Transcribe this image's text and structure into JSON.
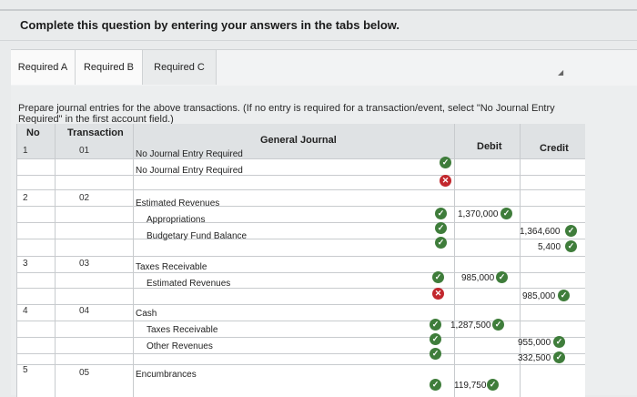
{
  "instruction": "Complete this question by entering your answers in the tabs below.",
  "tabs": [
    {
      "label": "Required A"
    },
    {
      "label": "Required B"
    },
    {
      "label": "Required C"
    }
  ],
  "prompt": "Prepare journal entries for the above transactions. (If no entry is required for a transaction/event, select \"No Journal Entry Required\" in the first account field.)",
  "table": {
    "headers": {
      "no": "No",
      "transaction": "Transaction",
      "journal": "General Journal",
      "debit": "Debit",
      "credit": "Credit"
    },
    "groups": [
      {
        "no": "1",
        "transaction": "01",
        "rows": [
          {
            "account": "No Journal Entry Required",
            "debit": "",
            "credit": ""
          },
          {
            "account": "No Journal Entry Required",
            "debit": "",
            "credit": ""
          }
        ]
      },
      {
        "no": "2",
        "transaction": "02",
        "rows": [
          {
            "account": "Estimated Revenues",
            "debit": "1,370,000",
            "credit": ""
          },
          {
            "account": "Appropriations",
            "debit": "",
            "credit": "1,364,600"
          },
          {
            "account": "Budgetary Fund Balance",
            "debit": "",
            "credit": "5,400"
          }
        ]
      },
      {
        "no": "3",
        "transaction": "03",
        "rows": [
          {
            "account": "Taxes Receivable",
            "debit": "985,000",
            "credit": ""
          },
          {
            "account": "Estimated Revenues",
            "debit": "",
            "credit": "985,000"
          }
        ]
      },
      {
        "no": "4",
        "transaction": "04",
        "rows": [
          {
            "account": "Cash",
            "debit": "1,287,500",
            "credit": ""
          },
          {
            "account": "Taxes Receivable",
            "debit": "",
            "credit": "955,000"
          },
          {
            "account": "Other Revenues",
            "debit": "",
            "credit": "332,500"
          }
        ]
      },
      {
        "no": "5",
        "transaction": "05",
        "rows": [
          {
            "account": "Encumbrances",
            "debit": "119,750",
            "credit": ""
          }
        ]
      }
    ]
  },
  "marks": {
    "ok": "✓",
    "bad": "✕"
  }
}
